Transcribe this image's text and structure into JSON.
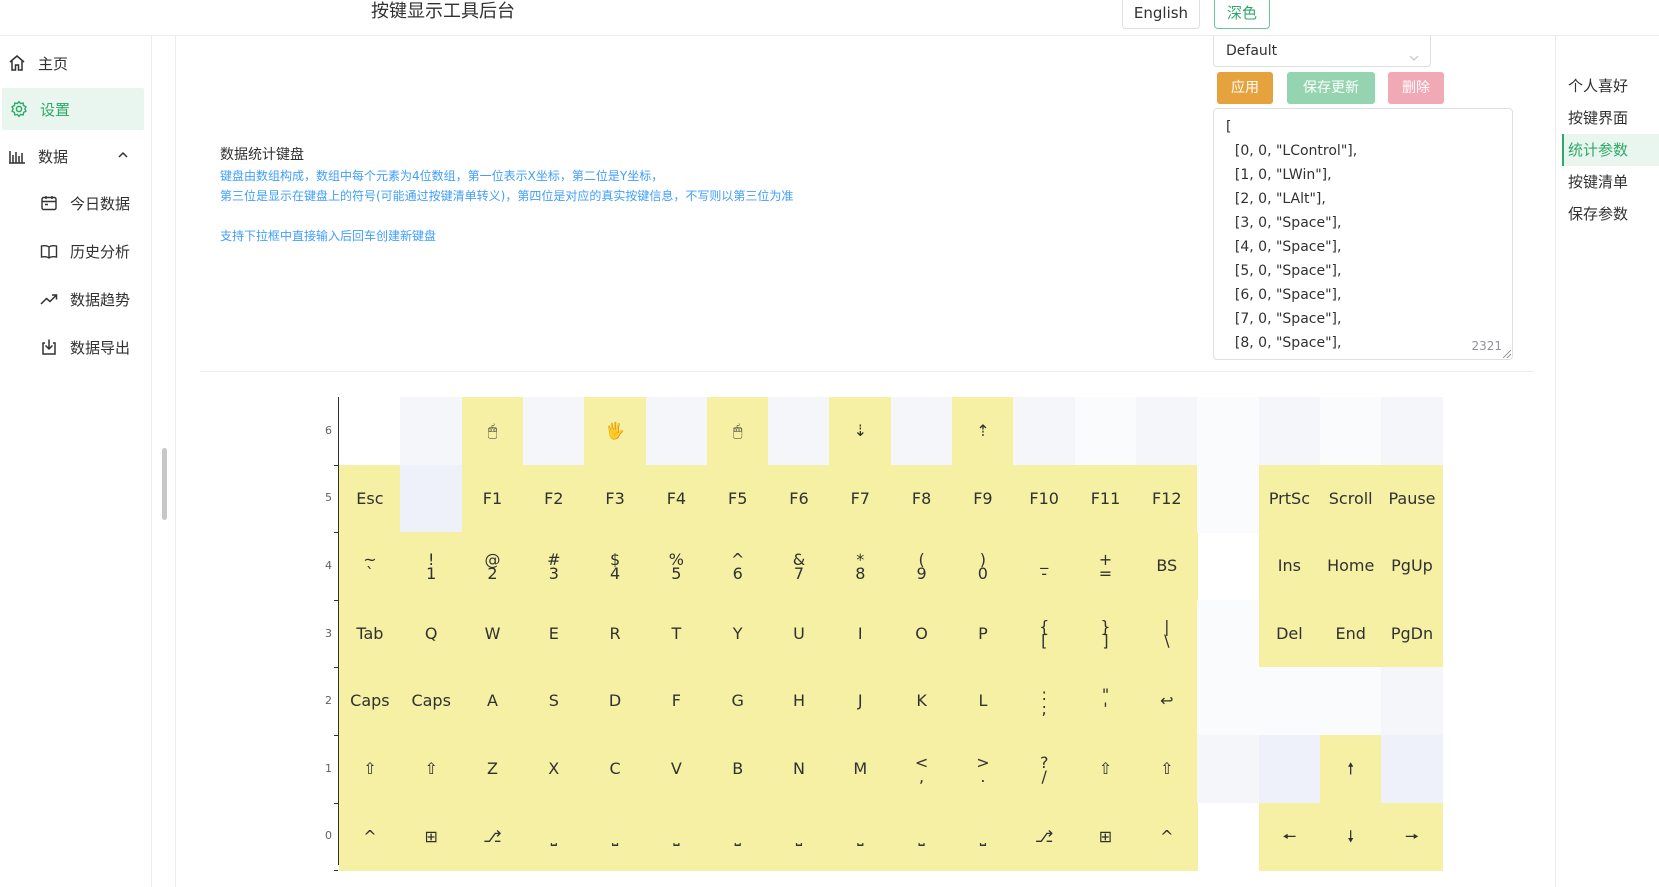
{
  "header": {
    "title": "按键显示工具后台",
    "lang_button": "English",
    "theme_button": "深色"
  },
  "sidebar": {
    "items": [
      {
        "label": "主页",
        "icon": "home-icon"
      },
      {
        "label": "设置",
        "icon": "gear-icon",
        "active": true
      },
      {
        "label": "数据",
        "icon": "bar-chart-icon",
        "expanded": true
      },
      {
        "label": "今日数据",
        "icon": "calendar-icon"
      },
      {
        "label": "历史分析",
        "icon": "book-icon"
      },
      {
        "label": "数据趋势",
        "icon": "trend-icon"
      },
      {
        "label": "数据导出",
        "icon": "download-icon"
      }
    ]
  },
  "settings": {
    "title": "数据统计键盘",
    "desc_lines": [
      "键盘由数组构成，数组中每个元素为4位数组，第一位表示X坐标，第二位是Y坐标，",
      "第三位是显示在键盘上的符号(可能通过按键清单转义)，第四位是对应的真实按键信息，不写则以第三位为准"
    ],
    "hint": "支持下拉框中直接输入后回车创建新键盘",
    "select_value": "Default",
    "buttons": {
      "apply": "应用",
      "save": "保存更新",
      "delete": "删除"
    },
    "textarea_lines": [
      "[",
      "  [0, 0, \"LControl\"],",
      "  [1, 0, \"LWin\"],",
      "  [2, 0, \"LAlt\"],",
      "  [3, 0, \"Space\"],",
      "  [4, 0, \"Space\"],",
      "  [5, 0, \"Space\"],",
      "  [6, 0, \"Space\"],",
      "  [7, 0, \"Space\"],",
      "  [8, 0, \"Space\"],"
    ],
    "char_count": "2321"
  },
  "anchor_nav": {
    "items": [
      "个人喜好",
      "按键界面",
      "统计参数",
      "按键清单",
      "保存参数"
    ],
    "active_index": 2
  },
  "colors": {
    "accent": "#2fa869",
    "key_on": "#f5f0a3",
    "key_off_a": "#f4f6fa",
    "key_off_b": "#eef1f9",
    "key_off_c": "#fafbfc"
  },
  "keyboard": {
    "y_labels": [
      "6",
      "5",
      "4",
      "3",
      "2",
      "1",
      "0"
    ],
    "rows": [
      {
        "y": 6,
        "keys": [
          {
            "x": 0,
            "l": "",
            "s": "none"
          },
          {
            "x": 1,
            "l": "",
            "s": "a"
          },
          {
            "x": 2,
            "l": "🖱",
            "s": "on",
            "ic": "mouse-icon"
          },
          {
            "x": 3,
            "l": "",
            "s": "a"
          },
          {
            "x": 4,
            "l": "🖐",
            "s": "on",
            "ic": "mouse-middle-icon"
          },
          {
            "x": 5,
            "l": "",
            "s": "a"
          },
          {
            "x": 6,
            "l": "🖱",
            "s": "on",
            "ic": "mouse-right-icon"
          },
          {
            "x": 7,
            "l": "",
            "s": "a"
          },
          {
            "x": 8,
            "l": "⇣",
            "s": "on"
          },
          {
            "x": 9,
            "l": "",
            "s": "a"
          },
          {
            "x": 10,
            "l": "⇡",
            "s": "on"
          },
          {
            "x": 11,
            "l": "",
            "s": "a"
          },
          {
            "x": 12,
            "l": "",
            "s": "c"
          },
          {
            "x": 13,
            "l": "",
            "s": "a"
          },
          {
            "x": 14,
            "l": "",
            "s": "c"
          },
          {
            "x": 15,
            "l": "",
            "s": "a"
          },
          {
            "x": 16,
            "l": "",
            "s": "c"
          },
          {
            "x": 17,
            "l": "",
            "s": "a"
          }
        ]
      },
      {
        "y": 5,
        "keys": [
          {
            "x": 0,
            "l": "Esc",
            "s": "on"
          },
          {
            "x": 1,
            "l": "",
            "s": "b"
          },
          {
            "x": 2,
            "l": "F1",
            "s": "on"
          },
          {
            "x": 3,
            "l": "F2",
            "s": "on"
          },
          {
            "x": 4,
            "l": "F3",
            "s": "on"
          },
          {
            "x": 5,
            "l": "F4",
            "s": "on"
          },
          {
            "x": 6,
            "l": "F5",
            "s": "on"
          },
          {
            "x": 7,
            "l": "F6",
            "s": "on"
          },
          {
            "x": 8,
            "l": "F7",
            "s": "on"
          },
          {
            "x": 9,
            "l": "F8",
            "s": "on"
          },
          {
            "x": 10,
            "l": "F9",
            "s": "on"
          },
          {
            "x": 11,
            "l": "F10",
            "s": "on"
          },
          {
            "x": 12,
            "l": "F11",
            "s": "on"
          },
          {
            "x": 13,
            "l": "F12",
            "s": "on"
          },
          {
            "x": 14,
            "l": "",
            "s": "c"
          },
          {
            "x": 15,
            "l": "PrtSc",
            "s": "on"
          },
          {
            "x": 16,
            "l": "Scroll",
            "s": "on"
          },
          {
            "x": 17,
            "l": "Pause",
            "s": "on"
          }
        ]
      },
      {
        "y": 4,
        "keys": [
          {
            "x": 0,
            "l": "~",
            "l2": "`",
            "s": "on"
          },
          {
            "x": 1,
            "l": "!",
            "l2": "1",
            "s": "on"
          },
          {
            "x": 2,
            "l": "@",
            "l2": "2",
            "s": "on"
          },
          {
            "x": 3,
            "l": "#",
            "l2": "3",
            "s": "on"
          },
          {
            "x": 4,
            "l": "$",
            "l2": "4",
            "s": "on"
          },
          {
            "x": 5,
            "l": "%",
            "l2": "5",
            "s": "on"
          },
          {
            "x": 6,
            "l": "^",
            "l2": "6",
            "s": "on"
          },
          {
            "x": 7,
            "l": "&",
            "l2": "7",
            "s": "on"
          },
          {
            "x": 8,
            "l": "*",
            "l2": "8",
            "s": "on"
          },
          {
            "x": 9,
            "l": "(",
            "l2": "9",
            "s": "on"
          },
          {
            "x": 10,
            "l": ")",
            "l2": "0",
            "s": "on"
          },
          {
            "x": 11,
            "l": "_",
            "l2": "-",
            "s": "on"
          },
          {
            "x": 12,
            "l": "+",
            "l2": "=",
            "s": "on"
          },
          {
            "x": 13,
            "l": "BS",
            "s": "on"
          },
          {
            "x": 14,
            "l": "",
            "s": "none"
          },
          {
            "x": 15,
            "l": "Ins",
            "s": "on"
          },
          {
            "x": 16,
            "l": "Home",
            "s": "on"
          },
          {
            "x": 17,
            "l": "PgUp",
            "s": "on"
          }
        ]
      },
      {
        "y": 3,
        "keys": [
          {
            "x": 0,
            "l": "Tab",
            "s": "on"
          },
          {
            "x": 1,
            "l": "Q",
            "s": "on"
          },
          {
            "x": 2,
            "l": "W",
            "s": "on"
          },
          {
            "x": 3,
            "l": "E",
            "s": "on"
          },
          {
            "x": 4,
            "l": "R",
            "s": "on"
          },
          {
            "x": 5,
            "l": "T",
            "s": "on"
          },
          {
            "x": 6,
            "l": "Y",
            "s": "on"
          },
          {
            "x": 7,
            "l": "U",
            "s": "on"
          },
          {
            "x": 8,
            "l": "I",
            "s": "on"
          },
          {
            "x": 9,
            "l": "O",
            "s": "on"
          },
          {
            "x": 10,
            "l": "P",
            "s": "on"
          },
          {
            "x": 11,
            "l": "{",
            "l2": "[",
            "s": "on"
          },
          {
            "x": 12,
            "l": "}",
            "l2": "]",
            "s": "on"
          },
          {
            "x": 13,
            "l": "|",
            "l2": "\\",
            "s": "on"
          },
          {
            "x": 14,
            "l": "",
            "s": "c"
          },
          {
            "x": 15,
            "l": "Del",
            "s": "on"
          },
          {
            "x": 16,
            "l": "End",
            "s": "on"
          },
          {
            "x": 17,
            "l": "PgDn",
            "s": "on"
          }
        ]
      },
      {
        "y": 2,
        "keys": [
          {
            "x": 0,
            "l": "Caps",
            "s": "on"
          },
          {
            "x": 1,
            "l": "Caps",
            "s": "on"
          },
          {
            "x": 2,
            "l": "A",
            "s": "on"
          },
          {
            "x": 3,
            "l": "S",
            "s": "on"
          },
          {
            "x": 4,
            "l": "D",
            "s": "on"
          },
          {
            "x": 5,
            "l": "F",
            "s": "on"
          },
          {
            "x": 6,
            "l": "G",
            "s": "on"
          },
          {
            "x": 7,
            "l": "H",
            "s": "on"
          },
          {
            "x": 8,
            "l": "J",
            "s": "on"
          },
          {
            "x": 9,
            "l": "K",
            "s": "on"
          },
          {
            "x": 10,
            "l": "L",
            "s": "on"
          },
          {
            "x": 11,
            "l": ":",
            "l2": ";",
            "s": "on"
          },
          {
            "x": 12,
            "l": "\"",
            "l2": "'",
            "s": "on"
          },
          {
            "x": 13,
            "l": "↩",
            "s": "on"
          },
          {
            "x": 14,
            "l": "",
            "s": "c"
          },
          {
            "x": 15,
            "l": "",
            "s": "c"
          },
          {
            "x": 16,
            "l": "",
            "s": "c"
          },
          {
            "x": 17,
            "l": "",
            "s": "a"
          }
        ]
      },
      {
        "y": 1,
        "keys": [
          {
            "x": 0,
            "l": "⇧",
            "s": "on"
          },
          {
            "x": 1,
            "l": "⇧",
            "s": "on"
          },
          {
            "x": 2,
            "l": "Z",
            "s": "on"
          },
          {
            "x": 3,
            "l": "X",
            "s": "on"
          },
          {
            "x": 4,
            "l": "C",
            "s": "on"
          },
          {
            "x": 5,
            "l": "V",
            "s": "on"
          },
          {
            "x": 6,
            "l": "B",
            "s": "on"
          },
          {
            "x": 7,
            "l": "N",
            "s": "on"
          },
          {
            "x": 8,
            "l": "M",
            "s": "on"
          },
          {
            "x": 9,
            "l": "<",
            "l2": ",",
            "s": "on"
          },
          {
            "x": 10,
            "l": ">",
            "l2": ".",
            "s": "on"
          },
          {
            "x": 11,
            "l": "?",
            "l2": "/",
            "s": "on"
          },
          {
            "x": 12,
            "l": "⇧",
            "s": "on"
          },
          {
            "x": 13,
            "l": "⇧",
            "s": "on"
          },
          {
            "x": 14,
            "l": "",
            "s": "a"
          },
          {
            "x": 15,
            "l": "",
            "s": "b"
          },
          {
            "x": 16,
            "l": "🠕",
            "s": "on"
          },
          {
            "x": 17,
            "l": "",
            "s": "b"
          }
        ]
      },
      {
        "y": 0,
        "keys": [
          {
            "x": 0,
            "l": "^",
            "s": "on"
          },
          {
            "x": 1,
            "l": "⊞",
            "s": "on"
          },
          {
            "x": 2,
            "l": "⎇",
            "s": "on"
          },
          {
            "x": 3,
            "l": "⎵",
            "s": "on"
          },
          {
            "x": 4,
            "l": "⎵",
            "s": "on"
          },
          {
            "x": 5,
            "l": "⎵",
            "s": "on"
          },
          {
            "x": 6,
            "l": "⎵",
            "s": "on"
          },
          {
            "x": 7,
            "l": "⎵",
            "s": "on"
          },
          {
            "x": 8,
            "l": "⎵",
            "s": "on"
          },
          {
            "x": 9,
            "l": "⎵",
            "s": "on"
          },
          {
            "x": 10,
            "l": "⎵",
            "s": "on"
          },
          {
            "x": 11,
            "l": "⎇",
            "s": "on"
          },
          {
            "x": 12,
            "l": "⊞",
            "s": "on"
          },
          {
            "x": 13,
            "l": "^",
            "s": "on"
          },
          {
            "x": 14,
            "l": "",
            "s": "none"
          },
          {
            "x": 15,
            "l": "🠔",
            "s": "on"
          },
          {
            "x": 16,
            "l": "🠗",
            "s": "on"
          },
          {
            "x": 17,
            "l": "🠖",
            "s": "on"
          }
        ]
      }
    ]
  }
}
